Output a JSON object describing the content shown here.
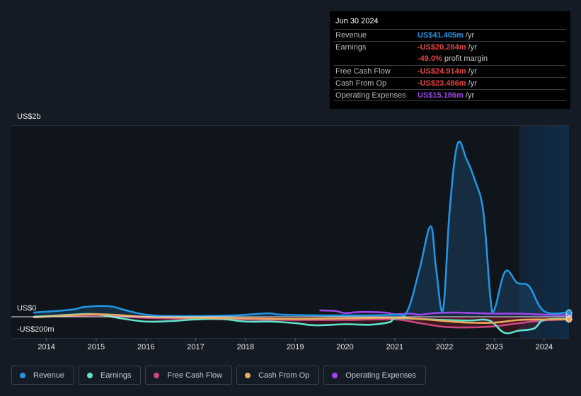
{
  "tooltip": {
    "date": "Jun 30 2024",
    "rows": [
      {
        "label": "Revenue",
        "value": "US$41.405m",
        "unit": " /yr",
        "color": "#2394e1"
      },
      {
        "label": "Earnings",
        "value": "-US$20.284m",
        "unit": " /yr",
        "color": "#e64545"
      },
      {
        "label": "",
        "value": "-49.0%",
        "unit": " profit margin",
        "color": "#e64545"
      },
      {
        "label": "Free Cash Flow",
        "value": "-US$24.914m",
        "unit": " /yr",
        "color": "#e64545"
      },
      {
        "label": "Cash From Op",
        "value": "-US$23.486m",
        "unit": " /yr",
        "color": "#e64545"
      },
      {
        "label": "Operating Expenses",
        "value": "US$15.186m",
        "unit": " /yr",
        "color": "#9d46ea"
      }
    ]
  },
  "legend": [
    {
      "label": "Revenue",
      "color": "#2394e1"
    },
    {
      "label": "Earnings",
      "color": "#5fe3cc"
    },
    {
      "label": "Free Cash Flow",
      "color": "#c9477f"
    },
    {
      "label": "Cash From Op",
      "color": "#e8aa5c"
    },
    {
      "label": "Operating Expenses",
      "color": "#9d46ea"
    }
  ],
  "chart_data": {
    "type": "line",
    "title": "",
    "xlabel": "",
    "ylabel": "",
    "unit": "US$m",
    "y_tick_labels": [
      "US$2b",
      "US$0",
      "-US$200m"
    ],
    "x_tick_labels": [
      "2014",
      "2015",
      "2016",
      "2017",
      "2018",
      "2019",
      "2020",
      "2021",
      "2022",
      "2023",
      "2024"
    ],
    "x_ticks": [
      2014,
      2015,
      2016,
      2017,
      2018,
      2019,
      2020,
      2021,
      2022,
      2023,
      2024
    ],
    "xlim": [
      2013.75,
      2024.5
    ],
    "ylim": [
      -200,
      1800
    ],
    "grid_values": [
      0,
      500,
      1000,
      1500
    ],
    "highlight_range": [
      2023.5,
      2024.5
    ],
    "grid": true,
    "legend_position": "bottom",
    "series": [
      {
        "name": "Revenue",
        "color": "#2394e1",
        "fill": true,
        "points": [
          [
            2013.75,
            40
          ],
          [
            2014.5,
            67
          ],
          [
            2014.77,
            93
          ],
          [
            2015.26,
            100
          ],
          [
            2015.55,
            67
          ],
          [
            2016.0,
            20
          ],
          [
            2016.6,
            7
          ],
          [
            2017.75,
            13
          ],
          [
            2018.45,
            33
          ],
          [
            2018.75,
            20
          ],
          [
            2019.9,
            13
          ],
          [
            2021.0,
            20
          ],
          [
            2021.25,
            53
          ],
          [
            2021.5,
            453
          ],
          [
            2021.72,
            853
          ],
          [
            2021.83,
            453
          ],
          [
            2021.97,
            67
          ],
          [
            2022.1,
            987
          ],
          [
            2022.26,
            1627
          ],
          [
            2022.44,
            1487
          ],
          [
            2022.61,
            1287
          ],
          [
            2022.78,
            987
          ],
          [
            2022.92,
            187
          ],
          [
            2023.0,
            67
          ],
          [
            2023.22,
            427
          ],
          [
            2023.46,
            320
          ],
          [
            2023.7,
            287
          ],
          [
            2024.0,
            53
          ],
          [
            2024.5,
            41
          ]
        ]
      },
      {
        "name": "Earnings",
        "color": "#5fe3cc",
        "points": [
          [
            2013.75,
            0
          ],
          [
            2014.5,
            20
          ],
          [
            2015.0,
            25
          ],
          [
            2015.5,
            -15
          ],
          [
            2016.0,
            -45
          ],
          [
            2016.5,
            -40
          ],
          [
            2017.0,
            -25
          ],
          [
            2017.5,
            -20
          ],
          [
            2018.0,
            -45
          ],
          [
            2018.5,
            -45
          ],
          [
            2019.0,
            -60
          ],
          [
            2019.4,
            -80
          ],
          [
            2020.0,
            -70
          ],
          [
            2020.5,
            -75
          ],
          [
            2020.9,
            -50
          ],
          [
            2021.0,
            -15
          ],
          [
            2021.5,
            -20
          ],
          [
            2022.0,
            -30
          ],
          [
            2022.5,
            -35
          ],
          [
            2022.9,
            -35
          ],
          [
            2023.2,
            -150
          ],
          [
            2023.5,
            -130
          ],
          [
            2023.8,
            -110
          ],
          [
            2024.0,
            -30
          ],
          [
            2024.5,
            -20
          ]
        ]
      },
      {
        "name": "Free Cash Flow",
        "color": "#c9477f",
        "points": [
          [
            2013.75,
            0
          ],
          [
            2014.5,
            10
          ],
          [
            2015.0,
            15
          ],
          [
            2015.5,
            5
          ],
          [
            2016.0,
            -10
          ],
          [
            2017.0,
            -20
          ],
          [
            2018.0,
            -25
          ],
          [
            2019.0,
            -30
          ],
          [
            2020.0,
            -30
          ],
          [
            2021.0,
            -25
          ],
          [
            2021.5,
            -60
          ],
          [
            2022.0,
            -95
          ],
          [
            2022.5,
            -100
          ],
          [
            2023.0,
            -90
          ],
          [
            2023.5,
            -60
          ],
          [
            2024.0,
            -35
          ],
          [
            2024.5,
            -25
          ]
        ]
      },
      {
        "name": "Cash From Op",
        "color": "#e8aa5c",
        "points": [
          [
            2013.75,
            -5
          ],
          [
            2014.5,
            15
          ],
          [
            2015.0,
            25
          ],
          [
            2015.5,
            15
          ],
          [
            2016.0,
            0
          ],
          [
            2017.0,
            -10
          ],
          [
            2018.0,
            -15
          ],
          [
            2019.0,
            -20
          ],
          [
            2020.0,
            -15
          ],
          [
            2021.0,
            -10
          ],
          [
            2021.5,
            -20
          ],
          [
            2022.0,
            -40
          ],
          [
            2022.5,
            -55
          ],
          [
            2023.0,
            -55
          ],
          [
            2023.5,
            -30
          ],
          [
            2024.0,
            -25
          ],
          [
            2024.5,
            -23
          ]
        ]
      },
      {
        "name": "Operating Expenses",
        "color": "#9d46ea",
        "points": [
          [
            2019.5,
            60
          ],
          [
            2019.8,
            55
          ],
          [
            2020.0,
            35
          ],
          [
            2020.3,
            45
          ],
          [
            2020.8,
            40
          ],
          [
            2021.0,
            25
          ],
          [
            2021.3,
            30
          ],
          [
            2021.5,
            20
          ],
          [
            2021.8,
            35
          ],
          [
            2022.2,
            40
          ],
          [
            2022.6,
            35
          ],
          [
            2023.0,
            30
          ],
          [
            2023.5,
            30
          ],
          [
            2024.0,
            20
          ],
          [
            2024.5,
            15
          ]
        ]
      }
    ]
  }
}
